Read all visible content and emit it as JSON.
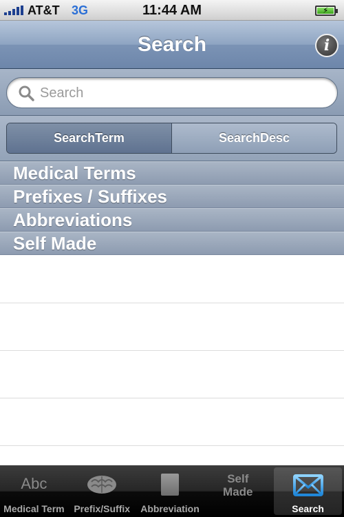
{
  "status_bar": {
    "carrier": "AT&T",
    "network": "3G",
    "time": "11:44 AM"
  },
  "nav_bar": {
    "title": "Search",
    "info_label": "i"
  },
  "search": {
    "placeholder": "Search",
    "value": ""
  },
  "segmented_control": {
    "segments": [
      {
        "label": "SearchTerm",
        "selected": true
      },
      {
        "label": "SearchDesc",
        "selected": false
      }
    ]
  },
  "sections": [
    {
      "label": "Medical Terms"
    },
    {
      "label": "Prefixes / Suffixes"
    },
    {
      "label": "Abbreviations"
    },
    {
      "label": "Self Made"
    }
  ],
  "tab_bar": {
    "tabs": [
      {
        "label": "Medical Term",
        "icon": "abc-icon",
        "icon_text": "Abc",
        "selected": false
      },
      {
        "label": "Prefix/Suffix",
        "icon": "brain-icon",
        "selected": false
      },
      {
        "label": "Abbreviation",
        "icon": "book-icon",
        "selected": false
      },
      {
        "label": "",
        "icon": "self-made-icon",
        "icon_text_line1": "Self",
        "icon_text_line2": "Made",
        "selected": false
      },
      {
        "label": "Search",
        "icon": "mail-icon",
        "selected": true
      }
    ]
  },
  "colors": {
    "nav_bar": "#7b93b5",
    "section_header": "#97a5b8",
    "tab_selected_icon": "#3fa8f0",
    "network_text": "#2b6fd6"
  }
}
